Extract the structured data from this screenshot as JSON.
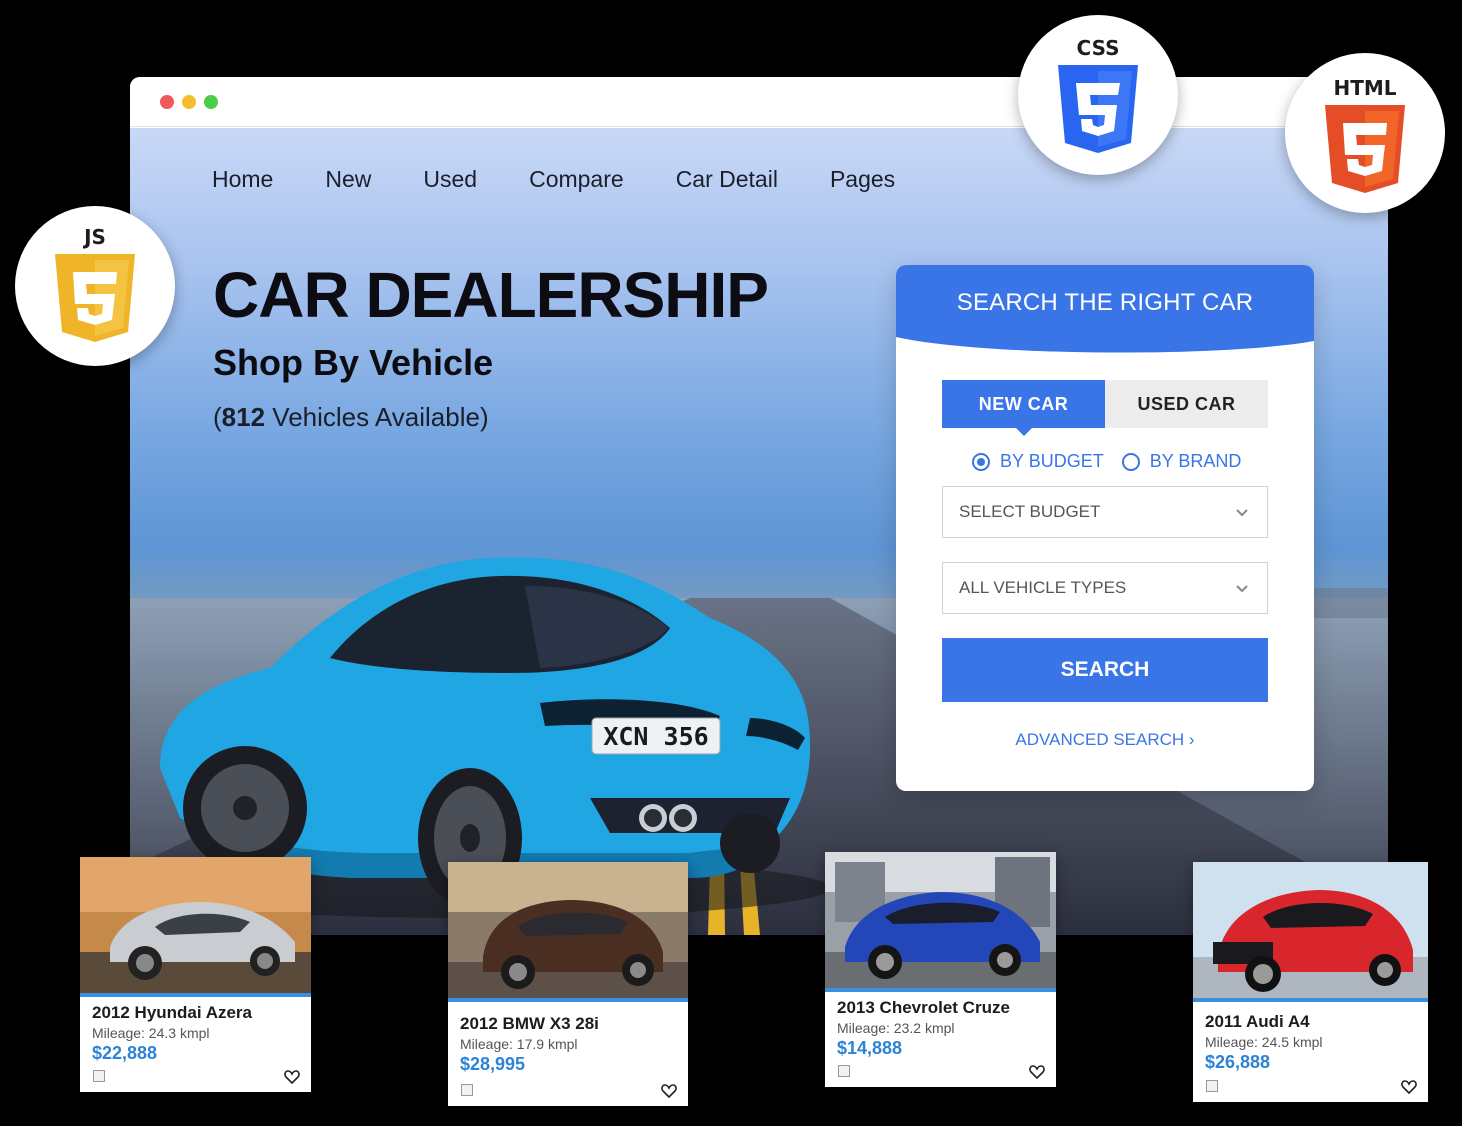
{
  "nav": {
    "home": "Home",
    "new": "New",
    "used": "Used",
    "compare": "Compare",
    "car_detail": "Car Detail",
    "pages": "Pages"
  },
  "hero": {
    "title": "CAR DEALERSHIP",
    "subtitle": "Shop By Vehicle",
    "count_open": "(",
    "count_number": "812",
    "count_text": " Vehicles Available)",
    "plate": "XCN 356"
  },
  "search_panel": {
    "title": "SEARCH THE RIGHT CAR",
    "tab_new": "NEW CAR",
    "tab_used": "USED CAR",
    "radio_budget": "BY BUDGET",
    "radio_brand": "BY BRAND",
    "select_budget": "SELECT BUDGET",
    "select_types": "ALL VEHICLE TYPES",
    "search_label": "SEARCH",
    "advanced_label": "ADVANCED SEARCH ›"
  },
  "badges": {
    "css": "CSS",
    "html": "HTML",
    "js": "JS"
  },
  "listings": [
    {
      "title": "2012 Hyundai Azera",
      "mileage": "Mileage: 24.3 kmpl",
      "price": "$22,888"
    },
    {
      "title": "2012 BMW X3 28i",
      "mileage": "Mileage: 17.9 kmpl",
      "price": "$28,995"
    },
    {
      "title": "2013 Chevrolet Cruze",
      "mileage": "Mileage: 23.2 kmpl",
      "price": "$14,888"
    },
    {
      "title": "2011 Audi A4",
      "mileage": "Mileage: 24.5 kmpl",
      "price": "$26,888"
    }
  ],
  "colors": {
    "accent": "#3a75e8",
    "price": "#2d84d6",
    "car_body": "#1fa6e3",
    "html_orange": "#e44d26",
    "css_blue": "#2965f1",
    "js_yellow": "#f0b429"
  }
}
